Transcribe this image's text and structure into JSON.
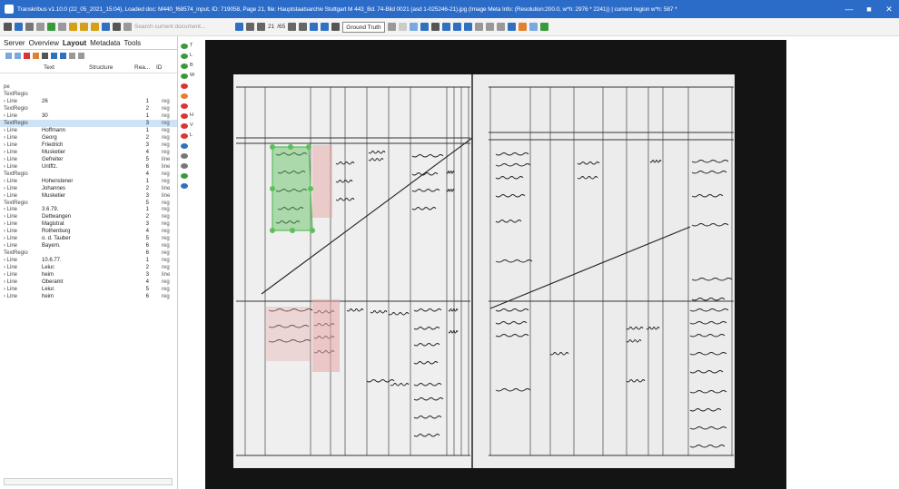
{
  "window": {
    "title": "Transkribus v1.10.0 (22_05_2021_15:04), Loaded doc: M440_f68574_input, ID: 719058, Page 21, file: Hauptstaatsarchiv Stuttgart M 443_Bd. 74-Bild 0021 (asd 1-025246-21).jpg (Image Meta Info: (Resolution:200.0, w*h: 2976 * 2241)) | current region w*h: 587 *"
  },
  "toolbar": {
    "search_placeholder": "Search current document...",
    "page_number": "21",
    "page_total": "/65",
    "mode_select": "Ground Truth"
  },
  "left_panel": {
    "tabs": [
      "Server",
      "Overview",
      "Layout",
      "Metadata",
      "Tools"
    ],
    "active_tab": "Layout",
    "columns": {
      "text": "Text",
      "structure": "Structure",
      "reading": "Rea...",
      "id": "ID"
    },
    "rows": [
      {
        "tree": "pe",
        "text": "",
        "num": "",
        "id": ""
      },
      {
        "tree": "TextRegio",
        "text": "",
        "num": "",
        "id": ""
      },
      {
        "tree": "› Line",
        "text": "26",
        "num": "1",
        "id": "reg"
      },
      {
        "tree": "TextRegio",
        "text": "",
        "num": "2",
        "id": "reg"
      },
      {
        "tree": "› Line",
        "text": "30",
        "num": "1",
        "id": "reg"
      },
      {
        "tree": "TextRegio",
        "text": "",
        "num": "3",
        "id": "reg"
      },
      {
        "tree": "› Line",
        "text": "Hoffmann",
        "num": "1",
        "id": "reg"
      },
      {
        "tree": "› Line",
        "text": "Georg",
        "num": "2",
        "id": "reg"
      },
      {
        "tree": "› Line",
        "text": "Friedrich",
        "num": "3",
        "id": "reg"
      },
      {
        "tree": "› Line",
        "text": "Musketier",
        "num": "4",
        "id": "reg"
      },
      {
        "tree": "› Line",
        "text": "Gefreiter",
        "num": "5",
        "id": "line"
      },
      {
        "tree": "› Line",
        "text": "Untffz.",
        "num": "6",
        "id": "line"
      },
      {
        "tree": "TextRegio",
        "text": "",
        "num": "4",
        "id": "reg"
      },
      {
        "tree": "› Line",
        "text": "Hohenstener",
        "num": "1",
        "id": "reg"
      },
      {
        "tree": "› Line",
        "text": "Johannes",
        "num": "2",
        "id": "line"
      },
      {
        "tree": "› Line",
        "text": "Musketier",
        "num": "3",
        "id": "line"
      },
      {
        "tree": "TextRegio",
        "text": "",
        "num": "5",
        "id": "reg"
      },
      {
        "tree": "› Line",
        "text": "3.6.79.",
        "num": "1",
        "id": "reg"
      },
      {
        "tree": "› Line",
        "text": "Dettwangen",
        "num": "2",
        "id": "reg"
      },
      {
        "tree": "› Line",
        "text": "Magistrat",
        "num": "3",
        "id": "reg"
      },
      {
        "tree": "› Line",
        "text": "Rothenburg",
        "num": "4",
        "id": "reg"
      },
      {
        "tree": "› Line",
        "text": "o. d. Tauber",
        "num": "5",
        "id": "reg"
      },
      {
        "tree": "› Line",
        "text": "Bayern.",
        "num": "6",
        "id": "reg"
      },
      {
        "tree": "TextRegio",
        "text": "",
        "num": "6",
        "id": "reg"
      },
      {
        "tree": "› Line",
        "text": "10.6.77.",
        "num": "1",
        "id": "reg"
      },
      {
        "tree": "› Line",
        "text": "Leiur.",
        "num": "2",
        "id": "reg"
      },
      {
        "tree": "› Line",
        "text": "heim",
        "num": "3",
        "id": "line"
      },
      {
        "tree": "› Line",
        "text": "Oberamt",
        "num": "4",
        "id": "reg"
      },
      {
        "tree": "› Line",
        "text": "Leiur.",
        "num": "5",
        "id": "reg"
      },
      {
        "tree": "› Line",
        "text": "heim",
        "num": "6",
        "id": "reg"
      }
    ]
  },
  "side_tools": [
    {
      "icon": "region-tool-icon",
      "label": "T",
      "color": "#3a9a3a"
    },
    {
      "icon": "line-tool-icon",
      "label": "L",
      "color": "#3a9a3a"
    },
    {
      "icon": "baseline-tool-icon",
      "label": "B",
      "color": "#3a9a3a"
    },
    {
      "icon": "word-tool-icon",
      "label": "W",
      "color": "#3a9a3a"
    },
    {
      "icon": "delete-tool-icon",
      "label": "",
      "color": "#d33"
    },
    {
      "icon": "merge-tool-icon",
      "label": "",
      "color": "#e08030"
    },
    {
      "icon": "split-tool-icon",
      "label": "",
      "color": "#d33"
    },
    {
      "icon": "split-h-tool-icon",
      "label": "H",
      "color": "#d33"
    },
    {
      "icon": "split-v-tool-icon",
      "label": "V",
      "color": "#d33"
    },
    {
      "icon": "split-l-tool-icon",
      "label": "L",
      "color": "#d33"
    },
    {
      "icon": "join-tool-icon",
      "label": "",
      "color": "#3070c0"
    },
    {
      "icon": "table-tool-icon",
      "label": "",
      "color": "#777"
    },
    {
      "icon": "crop-tool-icon",
      "label": "",
      "color": "#777"
    },
    {
      "icon": "pen-tool-icon",
      "label": "",
      "color": "#3a9a3a"
    },
    {
      "icon": "undo-tool-icon",
      "label": "",
      "color": "#3070c0"
    }
  ],
  "colors": {
    "titlebar": "#2c6cc9",
    "selected_row": "#cfe3f7",
    "selection_polygon": "#5cbf5c",
    "red_highlight": "#e8a6a6"
  }
}
